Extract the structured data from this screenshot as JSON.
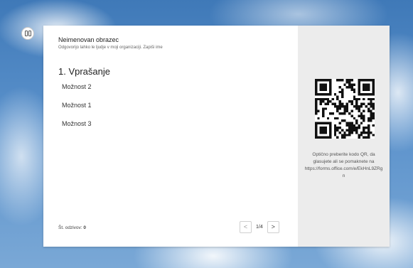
{
  "form": {
    "title": "Neimenovan obrazec",
    "subtitle": "Odgovorijo lahko le ljudje v moji organizaciji. Zapiši ime",
    "question": "1. Vprašanje",
    "options": [
      "Možnost 2",
      "Možnost 1",
      "Možnost 3"
    ],
    "responses_label": "Št. odzivov:",
    "responses_count": "0"
  },
  "pager": {
    "prev": "<",
    "label": "1/4",
    "next": ">"
  },
  "qr": {
    "instructions": "Optično preberite kodo QR, da glasujete ali se pomaknete na https://forms.office.com/e/EkHnL9ZRgn"
  },
  "icons": {
    "toggle": "panel-toggle-icon",
    "prev": "chevron-left-icon",
    "next": "chevron-right-icon",
    "qr": "qr-code"
  }
}
